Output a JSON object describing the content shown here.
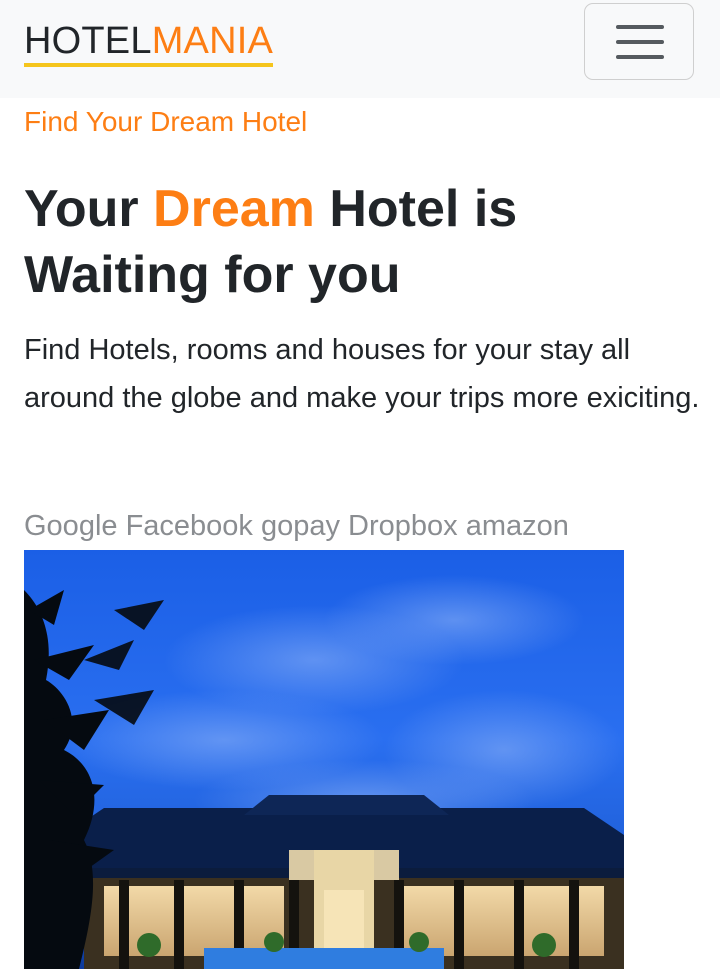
{
  "navbar": {
    "brand_part1": "HOTEL",
    "brand_part2": "MANIA",
    "toggler_icon": "hamburger-menu-icon"
  },
  "hero": {
    "eyebrow": "Find Your Dream Hotel",
    "headline_pre": "Your ",
    "headline_accent": "Dream",
    "headline_post": " Hotel is Waiting for you",
    "lead": "Find Hotels, rooms and houses for your stay all around the globe and make your trips more exiciting.",
    "partners": "Google Facebook gopay Dropbox amazon"
  },
  "colors": {
    "accent": "#fd7e14",
    "brand_underline": "#f5c51c",
    "navbar_bg": "#f8f9fa",
    "text": "#212529",
    "muted": "#8a8d91"
  }
}
